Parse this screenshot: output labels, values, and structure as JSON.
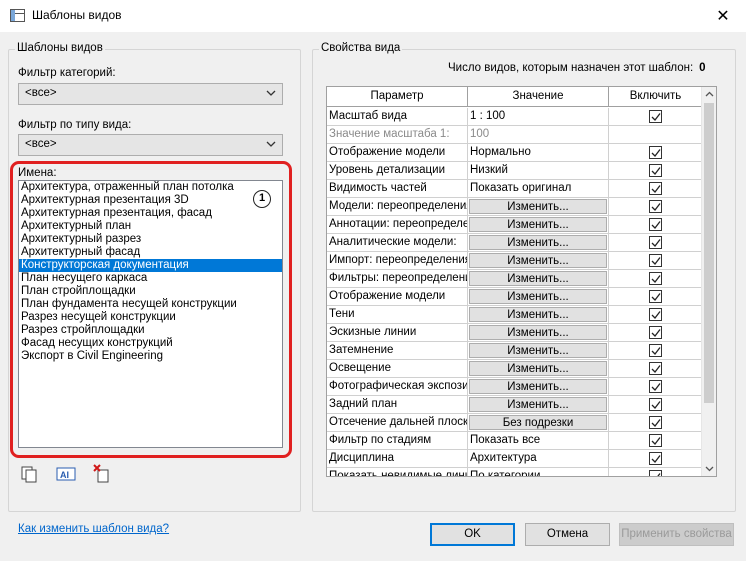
{
  "window": {
    "title": "Шаблоны видов",
    "close_glyph": "✕"
  },
  "left_panel": {
    "legend": "Шаблоны видов",
    "category_filter": {
      "label": "Фильтр категорий:",
      "value": "<все>"
    },
    "view_type_filter": {
      "label": "Фильтр по типу вида:",
      "value": "<все>"
    },
    "names_label": "Имена:",
    "callout_number": "1",
    "names": [
      "Архитектура, отраженный план потолка",
      "Архитектурная презентация 3D",
      "Архитектурная презентация, фасад",
      "Архитектурный план",
      "Архитектурный разрез",
      "Архитектурный фасад",
      "Конструкторская документация",
      "План несущего каркаса",
      "План стройплощадки",
      "План фундамента несущей конструкции",
      "Разрез несущей конструкции",
      "Разрез стройплощадки",
      "Фасад несущих конструкций",
      "Экспорт в Civil Engineering"
    ],
    "selected_name": "Конструкторская документация"
  },
  "right_panel": {
    "legend": "Свойства вида",
    "count_label": "Число видов, которым назначен этот шаблон:",
    "count_value": "0",
    "headers": {
      "param": "Параметр",
      "value": "Значение",
      "include": "Включить"
    },
    "rows": [
      {
        "param": "Масштаб вида",
        "value": "1 : 100",
        "kind": "text",
        "check": true
      },
      {
        "param": "Значение масштаба   1:",
        "value": "100",
        "kind": "text",
        "check": null,
        "dim": true
      },
      {
        "param": "Отображение модели",
        "value": "Нормально",
        "kind": "text",
        "check": true
      },
      {
        "param": "Уровень детализации",
        "value": "Низкий",
        "kind": "text",
        "check": true
      },
      {
        "param": "Видимость частей",
        "value": "Показать оригинал",
        "kind": "text",
        "check": true
      },
      {
        "param": "Модели: переопределения",
        "value": "Изменить...",
        "kind": "button",
        "check": true
      },
      {
        "param": "Аннотации: переопределения",
        "value": "Изменить...",
        "kind": "button",
        "check": true
      },
      {
        "param": "Аналитические модели:",
        "value": "Изменить...",
        "kind": "button",
        "check": true
      },
      {
        "param": "Импорт: переопределения",
        "value": "Изменить...",
        "kind": "button",
        "check": true
      },
      {
        "param": "Фильтры: переопределения",
        "value": "Изменить...",
        "kind": "button",
        "check": true
      },
      {
        "param": "Отображение модели",
        "value": "Изменить...",
        "kind": "button",
        "check": true
      },
      {
        "param": "Тени",
        "value": "Изменить...",
        "kind": "button",
        "check": true
      },
      {
        "param": "Эскизные линии",
        "value": "Изменить...",
        "kind": "button",
        "check": true
      },
      {
        "param": "Затемнение",
        "value": "Изменить...",
        "kind": "button",
        "check": true
      },
      {
        "param": "Освещение",
        "value": "Изменить...",
        "kind": "button",
        "check": true
      },
      {
        "param": "Фотографическая экспозиция",
        "value": "Изменить...",
        "kind": "button",
        "check": true
      },
      {
        "param": "Задний план",
        "value": "Изменить...",
        "kind": "button",
        "check": true
      },
      {
        "param": "Отсечение дальней плоскости",
        "value": "Без подрезки",
        "kind": "button",
        "check": true
      },
      {
        "param": "Фильтр по стадиям",
        "value": "Показать все",
        "kind": "text",
        "check": true
      },
      {
        "param": "Дисциплина",
        "value": "Архитектура",
        "kind": "text",
        "check": true
      },
      {
        "param": "Показать невидимые линии",
        "value": "По категории",
        "kind": "text",
        "check": true
      }
    ]
  },
  "footer": {
    "help_link": "Как изменить шаблон вида?",
    "ok": "OK",
    "cancel": "Отмена",
    "apply": "Применить свойства"
  },
  "colors": {
    "selection": "#0078d7",
    "highlight_ring": "#e02020",
    "link": "#0066cc"
  },
  "icons": [
    "app-icon",
    "close-icon",
    "chevron-down-icon",
    "duplicate-icon",
    "rename-icon",
    "delete-icon",
    "checkmark-icon",
    "scroll-up-icon",
    "scroll-down-icon"
  ]
}
